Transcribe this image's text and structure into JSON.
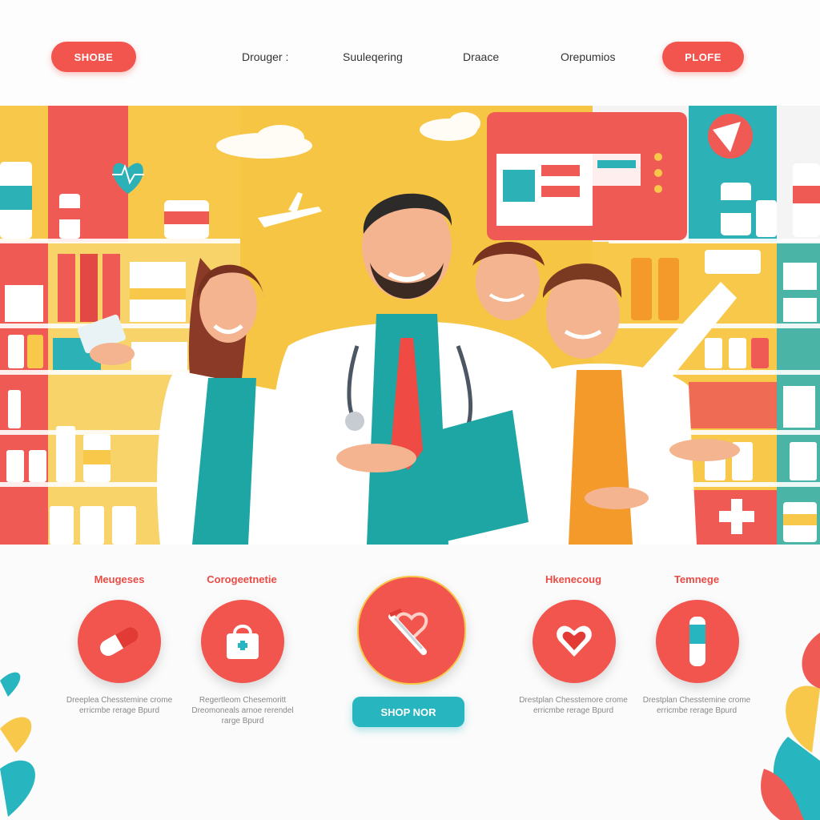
{
  "nav": {
    "left_button": "SHOBE",
    "links": [
      "Drouger :",
      "Suuleqering",
      "Draace",
      "Orepumios"
    ],
    "right_button": "PLOFE"
  },
  "categories": [
    {
      "label": "Meugeses",
      "desc": "Dreeplea Chesstemine crome erricmbe rerage Bpurd",
      "icon": "pill-icon"
    },
    {
      "label": "Corogeetnetie",
      "desc": "Regertleom Chesemoritt Dreomoneals arnoe rerendel rarge Bpurd",
      "icon": "first-aid-bag-icon"
    },
    {
      "label": "",
      "desc": "",
      "icon": "stethoscope-heart-icon"
    },
    {
      "label": "Hkenecoug",
      "desc": "Drestplan Chesstemore crome erricmbe rerage Bpurd",
      "icon": "heart-icon"
    },
    {
      "label": "Temnege",
      "desc": "Drestplan Chesstemine crome erricmbe rerage Bpurd",
      "icon": "inhaler-icon"
    }
  ],
  "cta": {
    "label": "SHOP NOR"
  },
  "colors": {
    "accent": "#f2554e",
    "teal": "#27b5bf",
    "yellow": "#f8c84a"
  }
}
